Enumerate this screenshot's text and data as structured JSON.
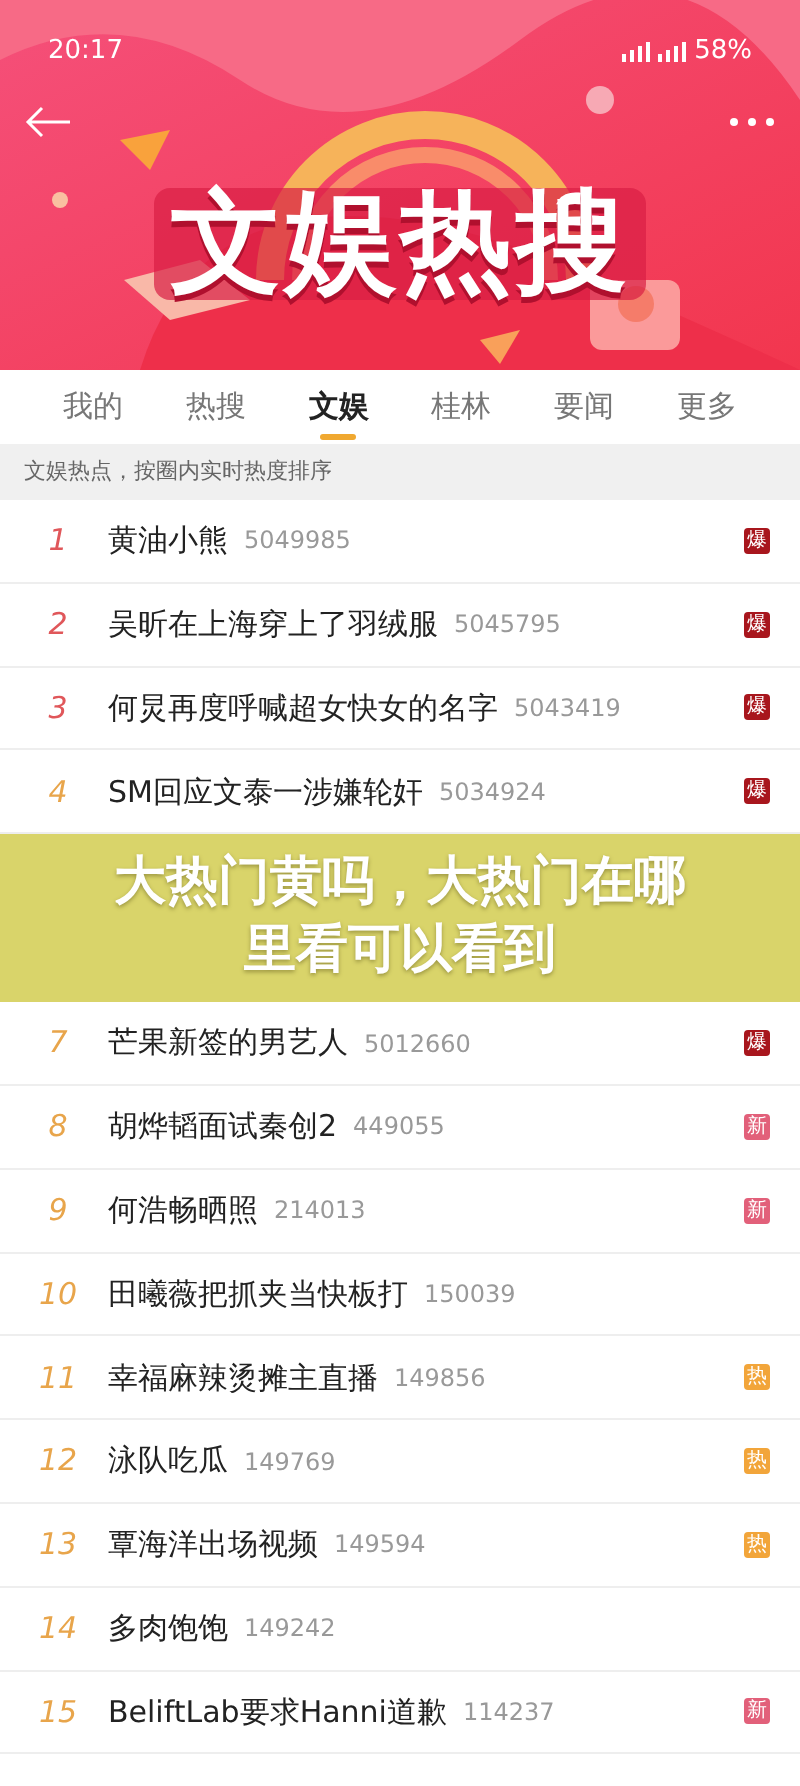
{
  "status_bar": {
    "time": "20:17",
    "battery": "58%"
  },
  "header": {
    "title": "文娱热搜"
  },
  "tabs": [
    {
      "label": "我的",
      "selected": false
    },
    {
      "label": "热搜",
      "selected": false
    },
    {
      "label": "文娱",
      "selected": true
    },
    {
      "label": "桂林",
      "selected": false
    },
    {
      "label": "要闻",
      "selected": false
    },
    {
      "label": "更多",
      "selected": false
    }
  ],
  "subtitle": "文娱热点，按圈内实时热度排序",
  "rows_above": [
    {
      "rank": "1",
      "top": true,
      "title": "黄油小熊",
      "count": "5049985",
      "badge": {
        "text": "爆",
        "kind": "boom"
      }
    },
    {
      "rank": "2",
      "top": true,
      "title": "吴昕在上海穿上了羽绒服",
      "count": "5045795",
      "badge": {
        "text": "爆",
        "kind": "boom"
      }
    },
    {
      "rank": "3",
      "top": true,
      "title": "何炅再度呼喊超女快女的名字",
      "count": "5043419",
      "badge": {
        "text": "爆",
        "kind": "boom"
      }
    },
    {
      "rank": "4",
      "top": false,
      "title": "SM回应文泰一涉嫌轮奸",
      "count": "5034924",
      "badge": {
        "text": "爆",
        "kind": "boom"
      }
    }
  ],
  "overlay_banner": {
    "text": "大热门黄吗，大热门在哪里看可以看到"
  },
  "rows_below": [
    {
      "rank": "7",
      "top": false,
      "title": "芒果新签的男艺人",
      "count": "5012660",
      "badge": {
        "text": "爆",
        "kind": "boom"
      }
    },
    {
      "rank": "8",
      "top": false,
      "title": "胡烨韬面试秦创2",
      "count": "449055",
      "badge": {
        "text": "新",
        "kind": "new"
      }
    },
    {
      "rank": "9",
      "top": false,
      "title": "何浩畅晒照",
      "count": "214013",
      "badge": {
        "text": "新",
        "kind": "new"
      }
    },
    {
      "rank": "10",
      "top": false,
      "title": "田曦薇把抓夹当快板打",
      "count": "150039"
    },
    {
      "rank": "11",
      "top": false,
      "title": "幸福麻辣烫摊主直播",
      "count": "149856",
      "badge": {
        "text": "热",
        "kind": "hot"
      }
    },
    {
      "rank": "12",
      "top": false,
      "title": "泳队吃瓜",
      "count": "149769",
      "badge": {
        "text": "热",
        "kind": "hot"
      }
    },
    {
      "rank": "13",
      "top": false,
      "title": "覃海洋出场视频",
      "count": "149594",
      "badge": {
        "text": "热",
        "kind": "hot"
      }
    },
    {
      "rank": "14",
      "top": false,
      "title": "多肉饱饱",
      "count": "149242"
    },
    {
      "rank": "15",
      "top": false,
      "title": "BeliftLab要求Hanni道歉",
      "count": "114237",
      "badge": {
        "text": "新",
        "kind": "new"
      }
    }
  ]
}
